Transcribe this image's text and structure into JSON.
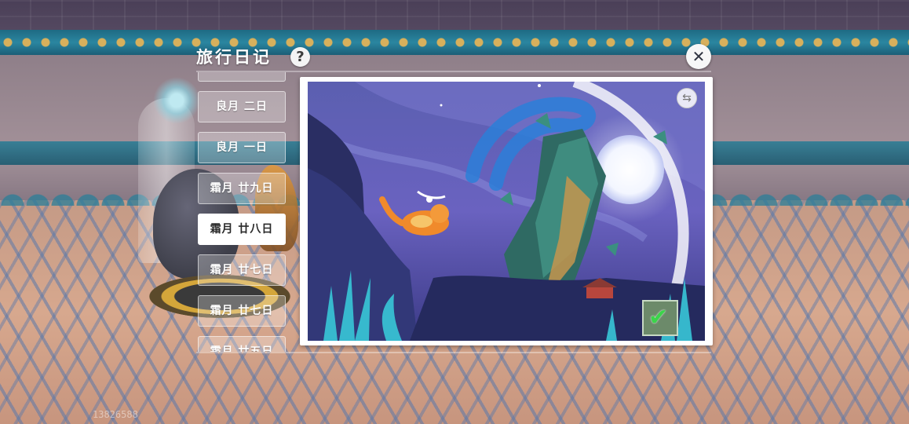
{
  "header": {
    "title": "旅行日记",
    "help_glyph": "?",
    "close_glyph": "✕"
  },
  "date_list": {
    "items": [
      {
        "label": ""
      },
      {
        "label": "良月 二日"
      },
      {
        "label": "良月 一日"
      },
      {
        "label": "霜月 廿九日"
      },
      {
        "label": "霜月 廿八日",
        "selected": true
      },
      {
        "label": "霜月 廿七日"
      },
      {
        "label": "霜月 廿七日"
      },
      {
        "label": "霜月 廿五日"
      }
    ]
  },
  "photo": {
    "swap_glyph": "⇆",
    "stamp_glyph": "✔"
  },
  "footer": {
    "user_id": "13826588"
  },
  "colors": {
    "accent": "#ffffff",
    "selected_text": "#2a2a2a",
    "stamp_check": "#3bd44a"
  }
}
